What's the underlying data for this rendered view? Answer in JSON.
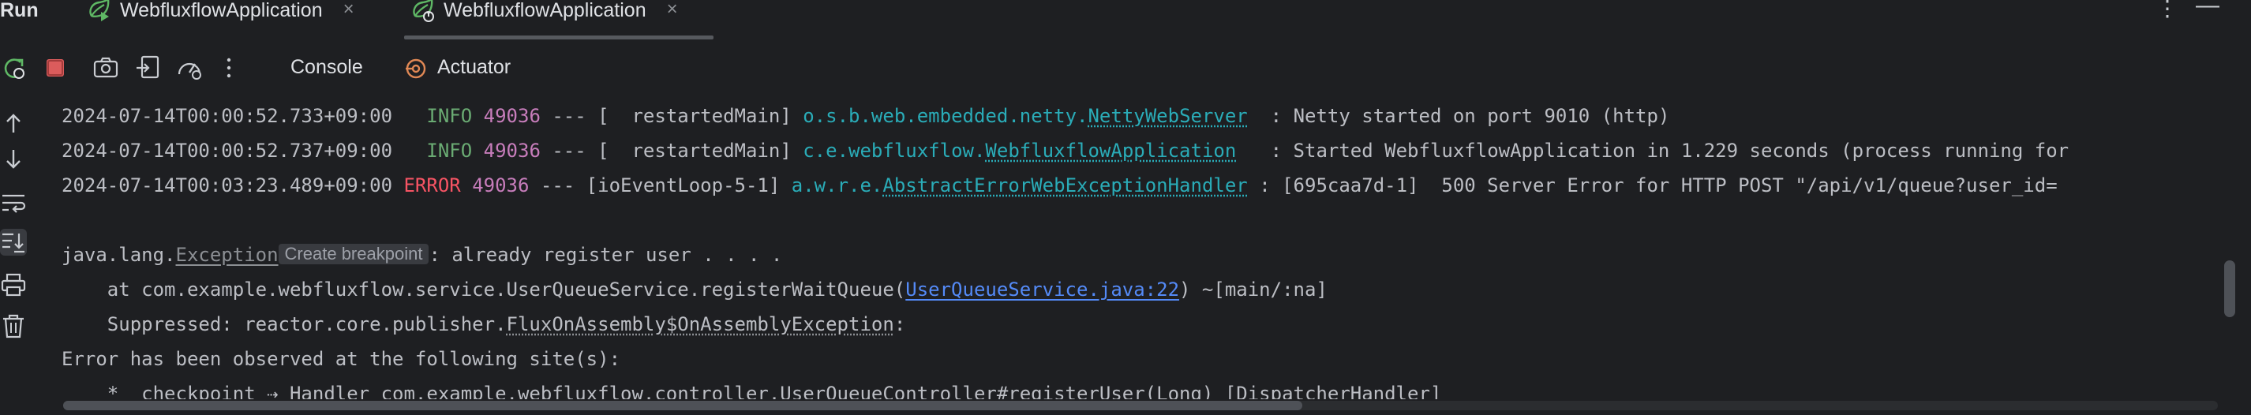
{
  "topbar": {
    "run_label": "Run",
    "tabs": [
      {
        "label": "WebfluxflowApplication"
      },
      {
        "label": "WebfluxflowApplication"
      }
    ],
    "close_glyph": "×",
    "more_glyph": "⋮",
    "minimize_glyph": "—"
  },
  "toolbar": {
    "console_tab": "Console",
    "actuator_tab": "Actuator"
  },
  "tooltip": {
    "create_breakpoint": "Create breakpoint"
  },
  "console": {
    "lines": [
      {
        "ts": "2024-07-14T00:00:52.733+09:00",
        "level": " INFO",
        "pid": "49036",
        "sep": " --- [  restartedMain] ",
        "logger_prefix": "o.s.b.web.embedded.netty.",
        "logger_class": "NettyWebServer",
        "message": "  : Netty started on port 9010 (http)"
      },
      {
        "ts": "2024-07-14T00:00:52.737+09:00",
        "level": " INFO",
        "pid": "49036",
        "sep": " --- [  restartedMain] ",
        "logger_prefix": "c.e.webfluxflow.",
        "logger_class": "WebfluxflowApplication",
        "message": "   : Started WebfluxflowApplication in 1.229 seconds (process running for"
      },
      {
        "ts": "2024-07-14T00:03:23.489+09:00",
        "level": "ERROR",
        "pid": "49036",
        "sep": " --- [ioEventLoop-5-1] ",
        "logger_prefix": "a.w.r.e.",
        "logger_class": "AbstractErrorWebExceptionHandler",
        "message": " : [695caa7d-1]  500 Server Error for HTTP POST \"/api/v1/queue?user_id="
      }
    ],
    "exception": {
      "prefix": "java.lang.",
      "class": "Exception",
      "message": ": already register user . . . ."
    },
    "stack_at_prefix": "    at com.example.webfluxflow.service.UserQueueService.registerWaitQueue(",
    "stack_at_link": "UserQueueService.java:22",
    "stack_at_suffix": ") ~[main/:na]",
    "suppressed_prefix": "    Suppressed: reactor.core.publisher.",
    "suppressed_class": "FluxOnAssembly$OnAssemblyException",
    "suppressed_suffix": ":",
    "observed": "Error has been observed at the following site(s):",
    "checkpoint": "    *__checkpoint ⇢ Handler com.example.webfluxflow.controller.UserQueueController#registerUser(Long) [DispatcherHandler]"
  },
  "colors": {
    "background": "#1e1f22",
    "info": "#6aab73",
    "error": "#f75464",
    "pid": "#c77dbb",
    "logger": "#2aacb8",
    "link": "#548af7",
    "stop": "#db5c5c"
  },
  "icons": {
    "tab": "spring-boot-run-icon",
    "rerun": "rerun-icon",
    "stop": "stop-icon",
    "screenshot": "camera-icon",
    "restore": "exit-restore-icon",
    "profiler": "gauge-icon",
    "more": "more-vertical-icon",
    "actuator": "actuator-icon",
    "up": "arrow-up-icon",
    "down": "arrow-down-icon",
    "wrap": "soft-wrap-icon",
    "scroll_end": "scroll-to-end-icon",
    "print": "print-icon",
    "clear": "trash-icon"
  }
}
